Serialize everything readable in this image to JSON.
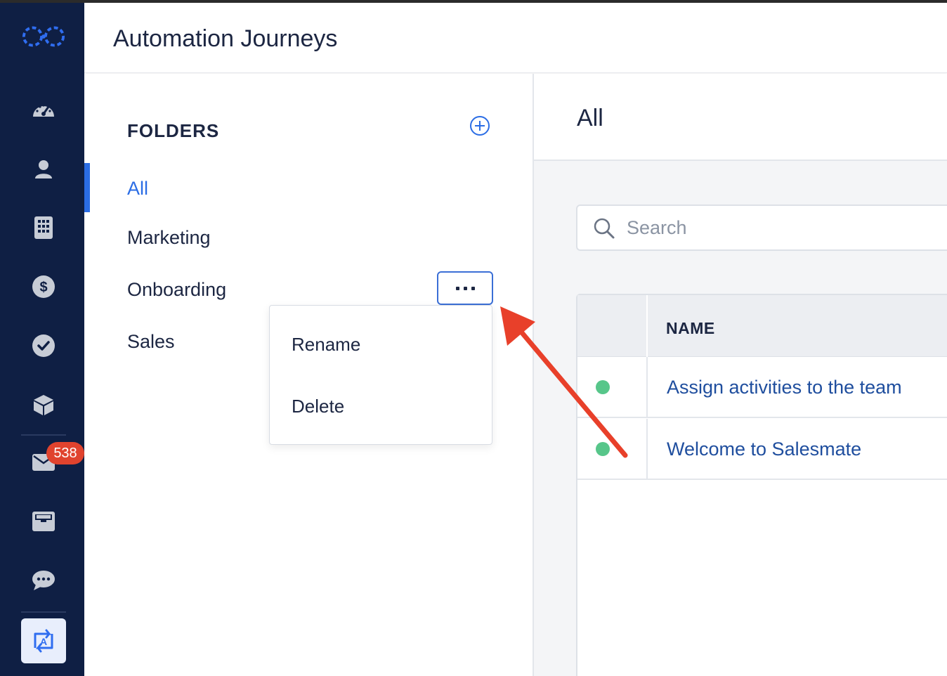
{
  "app": {
    "page_title": "Automation Journeys"
  },
  "nav": {
    "icons": [
      "logo-icon",
      "dashboard-icon",
      "contacts-icon",
      "companies-icon",
      "deals-icon",
      "tasks-icon",
      "products-icon",
      "email-icon",
      "inbox-icon",
      "chat-icon",
      "automation-icon"
    ],
    "email_badge": "538"
  },
  "folders": {
    "title": "FOLDERS",
    "items": [
      {
        "label": "All",
        "active": true
      },
      {
        "label": "Marketing"
      },
      {
        "label": "Onboarding"
      },
      {
        "label": "Sales"
      }
    ],
    "context_menu": {
      "items": [
        "Rename",
        "Delete"
      ]
    }
  },
  "main": {
    "title": "All",
    "search": {
      "placeholder": "Search",
      "value": ""
    },
    "table": {
      "columns": [
        "NAME"
      ],
      "rows": [
        {
          "name": "Assign activities to the team",
          "status": "active"
        },
        {
          "name": "Welcome to Salesmate",
          "status": "active"
        }
      ]
    }
  },
  "colors": {
    "nav_bg": "#0f1f44",
    "accent": "#2b6de5",
    "status_active": "#57c68a",
    "badge": "#e0432e",
    "annotation_arrow": "#e8402a"
  }
}
